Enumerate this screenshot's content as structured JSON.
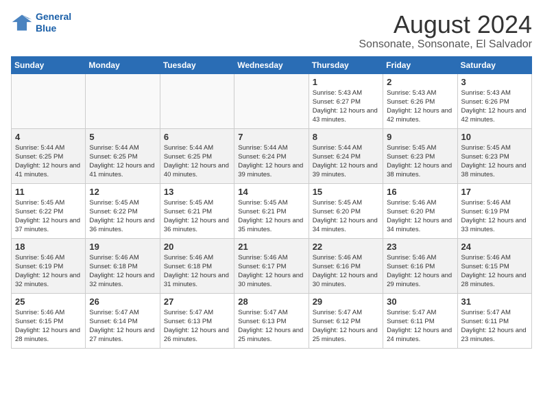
{
  "header": {
    "logo_line1": "General",
    "logo_line2": "Blue",
    "title": "August 2024",
    "subtitle": "Sonsonate, Sonsonate, El Salvador"
  },
  "days_of_week": [
    "Sunday",
    "Monday",
    "Tuesday",
    "Wednesday",
    "Thursday",
    "Friday",
    "Saturday"
  ],
  "weeks": [
    [
      {
        "day": "",
        "info": ""
      },
      {
        "day": "",
        "info": ""
      },
      {
        "day": "",
        "info": ""
      },
      {
        "day": "",
        "info": ""
      },
      {
        "day": "1",
        "info": "Sunrise: 5:43 AM\nSunset: 6:27 PM\nDaylight: 12 hours and 43 minutes."
      },
      {
        "day": "2",
        "info": "Sunrise: 5:43 AM\nSunset: 6:26 PM\nDaylight: 12 hours and 42 minutes."
      },
      {
        "day": "3",
        "info": "Sunrise: 5:43 AM\nSunset: 6:26 PM\nDaylight: 12 hours and 42 minutes."
      }
    ],
    [
      {
        "day": "4",
        "info": "Sunrise: 5:44 AM\nSunset: 6:25 PM\nDaylight: 12 hours and 41 minutes."
      },
      {
        "day": "5",
        "info": "Sunrise: 5:44 AM\nSunset: 6:25 PM\nDaylight: 12 hours and 41 minutes."
      },
      {
        "day": "6",
        "info": "Sunrise: 5:44 AM\nSunset: 6:25 PM\nDaylight: 12 hours and 40 minutes."
      },
      {
        "day": "7",
        "info": "Sunrise: 5:44 AM\nSunset: 6:24 PM\nDaylight: 12 hours and 39 minutes."
      },
      {
        "day": "8",
        "info": "Sunrise: 5:44 AM\nSunset: 6:24 PM\nDaylight: 12 hours and 39 minutes."
      },
      {
        "day": "9",
        "info": "Sunrise: 5:45 AM\nSunset: 6:23 PM\nDaylight: 12 hours and 38 minutes."
      },
      {
        "day": "10",
        "info": "Sunrise: 5:45 AM\nSunset: 6:23 PM\nDaylight: 12 hours and 38 minutes."
      }
    ],
    [
      {
        "day": "11",
        "info": "Sunrise: 5:45 AM\nSunset: 6:22 PM\nDaylight: 12 hours and 37 minutes."
      },
      {
        "day": "12",
        "info": "Sunrise: 5:45 AM\nSunset: 6:22 PM\nDaylight: 12 hours and 36 minutes."
      },
      {
        "day": "13",
        "info": "Sunrise: 5:45 AM\nSunset: 6:21 PM\nDaylight: 12 hours and 36 minutes."
      },
      {
        "day": "14",
        "info": "Sunrise: 5:45 AM\nSunset: 6:21 PM\nDaylight: 12 hours and 35 minutes."
      },
      {
        "day": "15",
        "info": "Sunrise: 5:45 AM\nSunset: 6:20 PM\nDaylight: 12 hours and 34 minutes."
      },
      {
        "day": "16",
        "info": "Sunrise: 5:46 AM\nSunset: 6:20 PM\nDaylight: 12 hours and 34 minutes."
      },
      {
        "day": "17",
        "info": "Sunrise: 5:46 AM\nSunset: 6:19 PM\nDaylight: 12 hours and 33 minutes."
      }
    ],
    [
      {
        "day": "18",
        "info": "Sunrise: 5:46 AM\nSunset: 6:19 PM\nDaylight: 12 hours and 32 minutes."
      },
      {
        "day": "19",
        "info": "Sunrise: 5:46 AM\nSunset: 6:18 PM\nDaylight: 12 hours and 32 minutes."
      },
      {
        "day": "20",
        "info": "Sunrise: 5:46 AM\nSunset: 6:18 PM\nDaylight: 12 hours and 31 minutes."
      },
      {
        "day": "21",
        "info": "Sunrise: 5:46 AM\nSunset: 6:17 PM\nDaylight: 12 hours and 30 minutes."
      },
      {
        "day": "22",
        "info": "Sunrise: 5:46 AM\nSunset: 6:16 PM\nDaylight: 12 hours and 30 minutes."
      },
      {
        "day": "23",
        "info": "Sunrise: 5:46 AM\nSunset: 6:16 PM\nDaylight: 12 hours and 29 minutes."
      },
      {
        "day": "24",
        "info": "Sunrise: 5:46 AM\nSunset: 6:15 PM\nDaylight: 12 hours and 28 minutes."
      }
    ],
    [
      {
        "day": "25",
        "info": "Sunrise: 5:46 AM\nSunset: 6:15 PM\nDaylight: 12 hours and 28 minutes."
      },
      {
        "day": "26",
        "info": "Sunrise: 5:47 AM\nSunset: 6:14 PM\nDaylight: 12 hours and 27 minutes."
      },
      {
        "day": "27",
        "info": "Sunrise: 5:47 AM\nSunset: 6:13 PM\nDaylight: 12 hours and 26 minutes."
      },
      {
        "day": "28",
        "info": "Sunrise: 5:47 AM\nSunset: 6:13 PM\nDaylight: 12 hours and 25 minutes."
      },
      {
        "day": "29",
        "info": "Sunrise: 5:47 AM\nSunset: 6:12 PM\nDaylight: 12 hours and 25 minutes."
      },
      {
        "day": "30",
        "info": "Sunrise: 5:47 AM\nSunset: 6:11 PM\nDaylight: 12 hours and 24 minutes."
      },
      {
        "day": "31",
        "info": "Sunrise: 5:47 AM\nSunset: 6:11 PM\nDaylight: 12 hours and 23 minutes."
      }
    ]
  ]
}
